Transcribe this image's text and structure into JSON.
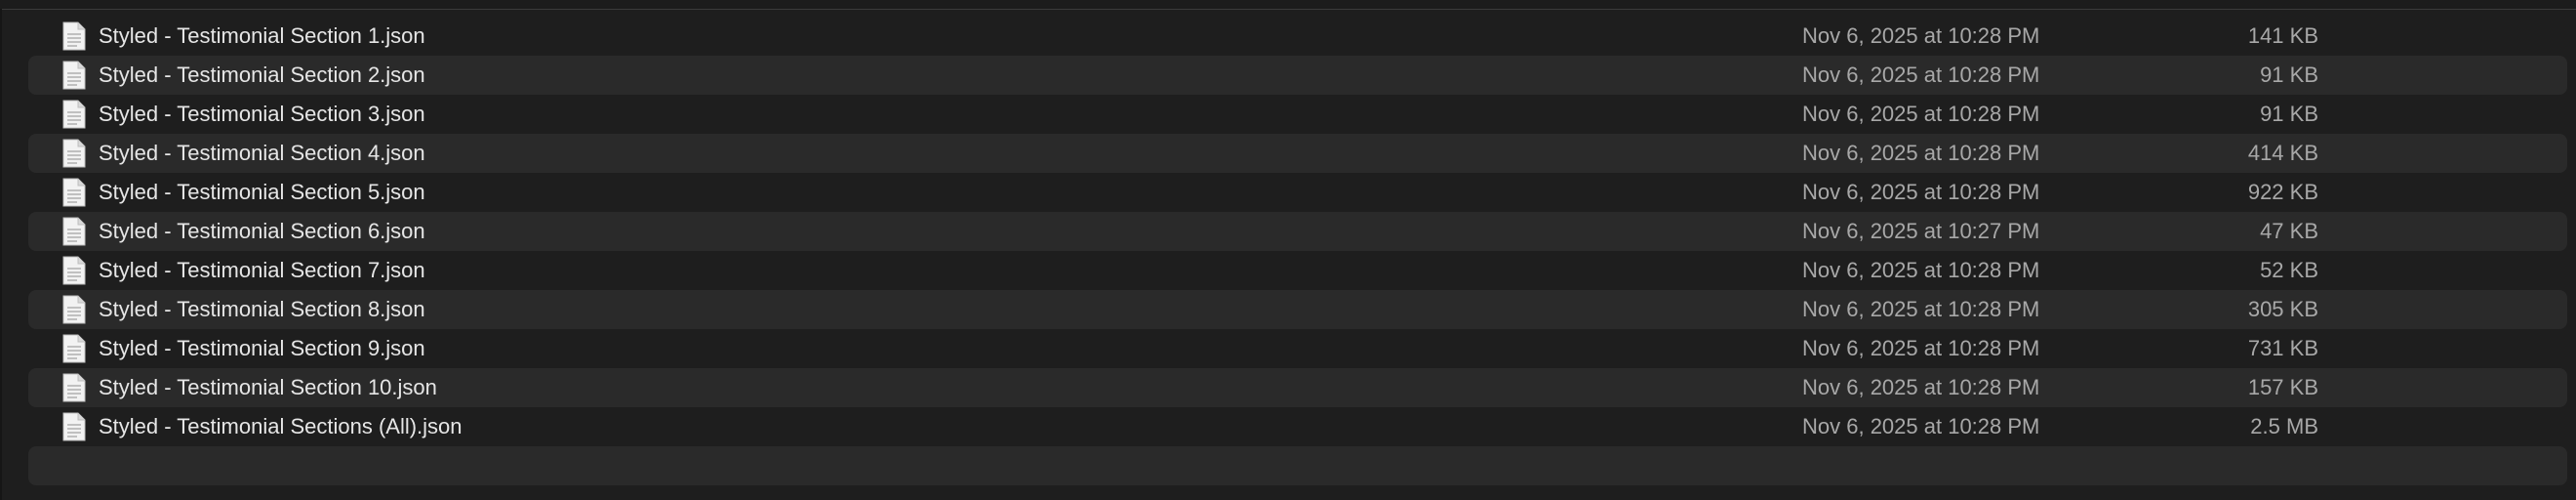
{
  "files": [
    {
      "name": "Styled - Testimonial Section 1.json",
      "date": "Nov 6, 2025 at 10:28 PM",
      "size": "141 KB",
      "icon": "document-icon"
    },
    {
      "name": "Styled - Testimonial Section 2.json",
      "date": "Nov 6, 2025 at 10:28 PM",
      "size": "91 KB",
      "icon": "document-icon"
    },
    {
      "name": "Styled - Testimonial Section 3.json",
      "date": "Nov 6, 2025 at 10:28 PM",
      "size": "91 KB",
      "icon": "document-icon"
    },
    {
      "name": "Styled - Testimonial Section 4.json",
      "date": "Nov 6, 2025 at 10:28 PM",
      "size": "414 KB",
      "icon": "document-icon"
    },
    {
      "name": "Styled - Testimonial Section 5.json",
      "date": "Nov 6, 2025 at 10:28 PM",
      "size": "922 KB",
      "icon": "document-icon"
    },
    {
      "name": "Styled - Testimonial Section 6.json",
      "date": "Nov 6, 2025 at 10:27 PM",
      "size": "47 KB",
      "icon": "document-icon"
    },
    {
      "name": "Styled - Testimonial Section 7.json",
      "date": "Nov 6, 2025 at 10:28 PM",
      "size": "52 KB",
      "icon": "document-icon"
    },
    {
      "name": "Styled - Testimonial Section 8.json",
      "date": "Nov 6, 2025 at 10:28 PM",
      "size": "305 KB",
      "icon": "document-icon"
    },
    {
      "name": "Styled - Testimonial Section 9.json",
      "date": "Nov 6, 2025 at 10:28 PM",
      "size": "731 KB",
      "icon": "document-icon"
    },
    {
      "name": "Styled - Testimonial Section 10.json",
      "date": "Nov 6, 2025 at 10:28 PM",
      "size": "157 KB",
      "icon": "document-icon"
    },
    {
      "name": "Styled - Testimonial Sections (All).json",
      "date": "Nov 6, 2025 at 10:28 PM",
      "size": "2.5 MB",
      "icon": "document-icon"
    }
  ],
  "colors": {
    "background": "#1e1e1e",
    "row_alt": "#2a2a2a",
    "name_text": "#e6e6e6",
    "meta_text": "#a8a8a8"
  }
}
